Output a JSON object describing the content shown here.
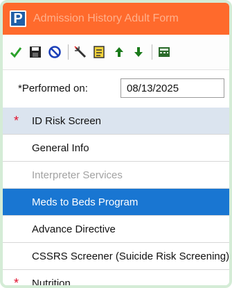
{
  "window": {
    "app_icon_letter": "P",
    "title": "Admission History Adult Form"
  },
  "toolbar": {
    "buttons": [
      {
        "name": "check-icon",
        "color": "#2aa12a"
      },
      {
        "name": "save-icon",
        "color": "#222222"
      },
      {
        "name": "cancel-icon",
        "color": "#1b3fb8"
      },
      {
        "name": "magic-wand-icon",
        "color": "#333333"
      },
      {
        "name": "form-icon",
        "color": "#c9a200"
      },
      {
        "name": "up-arrow-icon",
        "color": "#1a7a1a"
      },
      {
        "name": "down-arrow-icon",
        "color": "#1a7a1a"
      },
      {
        "name": "calculator-icon",
        "color": "#2b6b2b"
      }
    ]
  },
  "performed": {
    "label": "*Performed on:",
    "value": "08/13/2025"
  },
  "nav": {
    "items": [
      {
        "label": "ID Risk Screen",
        "required": true,
        "state": "header"
      },
      {
        "label": "General Info",
        "required": false,
        "state": "normal"
      },
      {
        "label": "Interpreter Services",
        "required": false,
        "state": "disabled"
      },
      {
        "label": "Meds to Beds Program",
        "required": false,
        "state": "selected"
      },
      {
        "label": "Advance Directive",
        "required": false,
        "state": "normal"
      },
      {
        "label": "CSSRS Screener (Suicide Risk Screening)",
        "required": false,
        "state": "normal"
      },
      {
        "label": "Nutrition",
        "required": true,
        "state": "normal"
      }
    ],
    "required_marker": "*"
  },
  "colors": {
    "titlebar": "#ff6a2c",
    "selected": "#1976d2",
    "header_row": "#dbe4ef"
  }
}
